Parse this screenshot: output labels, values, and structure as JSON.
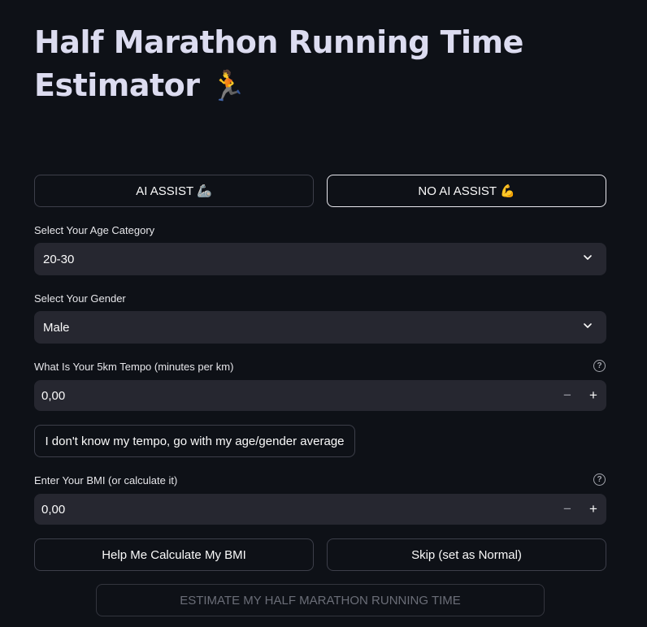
{
  "header": {
    "title": "Half Marathon Running Time Estimator",
    "title_emoji": "🏃"
  },
  "mode_buttons": {
    "ai_assist": "AI ASSIST 🦾",
    "no_ai_assist": "NO AI ASSIST 💪"
  },
  "age": {
    "label": "Select Your Age Category",
    "value": "20-30"
  },
  "gender": {
    "label": "Select Your Gender",
    "value": "Male"
  },
  "tempo": {
    "label": "What Is Your 5km Tempo (minutes per km)",
    "value": "0,00",
    "help": "?",
    "unknown_button": "I don't know my tempo, go with my age/gender average"
  },
  "bmi": {
    "label": "Enter Your BMI (or calculate it)",
    "value": "0,00",
    "help": "?",
    "calculate_button": "Help Me Calculate My BMI",
    "skip_button": "Skip (set as Normal)"
  },
  "estimate_button": "ESTIMATE MY HALF MARATHON RUNNING TIME",
  "stepper": {
    "minus": "−",
    "plus": "+"
  },
  "colors": {
    "background": "#0e1117",
    "input_bg": "#262730",
    "title": "#dcdcf0",
    "border": "#3d3f4a",
    "active_border": "#e8e8ee"
  }
}
